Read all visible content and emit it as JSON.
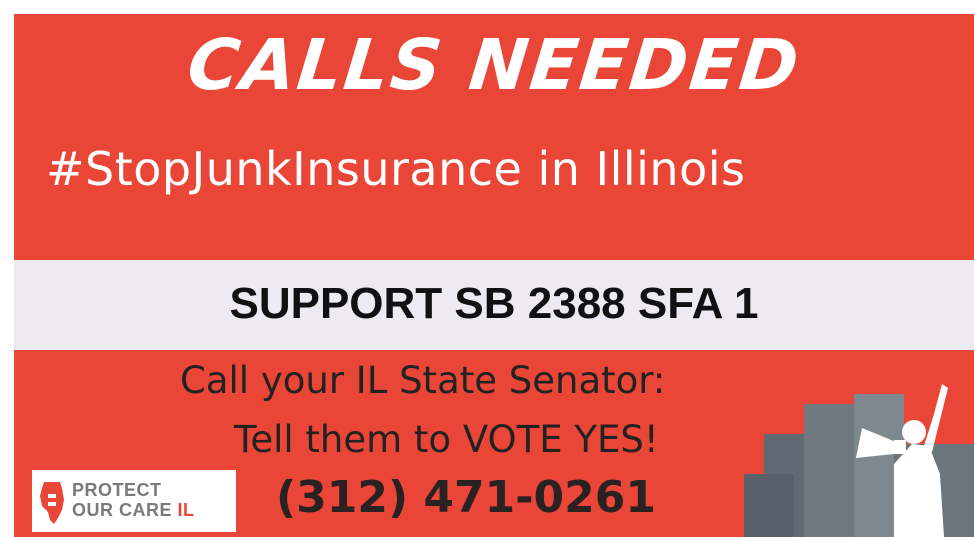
{
  "headline": "CALLS NEEDED",
  "hashtag": "#StopJunkInsurance in Illinois",
  "band": "SUPPORT SB 2388 SFA 1",
  "instructions": {
    "line1": "Call your IL State Senator:",
    "line2": "Tell them to VOTE YES!"
  },
  "phone": "(312) 471-0261",
  "logo": {
    "line1": "PROTECT",
    "line2": "OUR CARE",
    "suffix": "IL"
  },
  "icons": {
    "logo": "illinois-state-icon",
    "artwork": "protester-megaphone-icon"
  },
  "colors": {
    "background": "#ea4638",
    "band": "#eeeaf2",
    "text_dark": "#222222",
    "text_light": "#ffffff"
  }
}
